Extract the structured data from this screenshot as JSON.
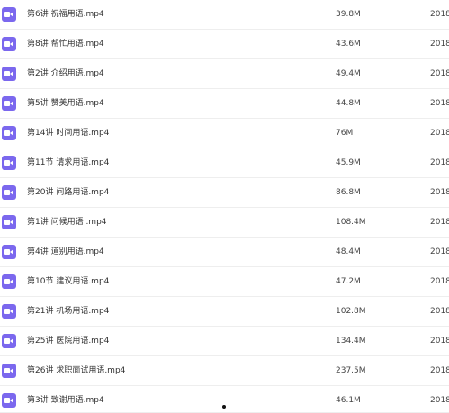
{
  "files": [
    {
      "name": "第6讲 祝福用语.mp4",
      "size": "39.8M",
      "date": "2018-"
    },
    {
      "name": "第8讲 帮忙用语.mp4",
      "size": "43.6M",
      "date": "2018-"
    },
    {
      "name": "第2讲 介绍用语.mp4",
      "size": "49.4M",
      "date": "2018-"
    },
    {
      "name": "第5讲 赞美用语.mp4",
      "size": "44.8M",
      "date": "2018-"
    },
    {
      "name": "第14讲 时间用语.mp4",
      "size": "76M",
      "date": "2018-"
    },
    {
      "name": "第11节 请求用语.mp4",
      "size": "45.9M",
      "date": "2018-"
    },
    {
      "name": "第20讲 问路用语.mp4",
      "size": "86.8M",
      "date": "2018-"
    },
    {
      "name": "第1讲 问候用语 .mp4",
      "size": "108.4M",
      "date": "2018-"
    },
    {
      "name": "第4讲 道别用语.mp4",
      "size": "48.4M",
      "date": "2018-"
    },
    {
      "name": "第10节 建议用语.mp4",
      "size": "47.2M",
      "date": "2018-"
    },
    {
      "name": "第21讲 机场用语.mp4",
      "size": "102.8M",
      "date": "2018-"
    },
    {
      "name": "第25讲 医院用语.mp4",
      "size": "134.4M",
      "date": "2018-"
    },
    {
      "name": "第26讲 求职面试用语.mp4",
      "size": "237.5M",
      "date": "2018-"
    },
    {
      "name": "第3讲 致谢用语.mp4",
      "size": "46.1M",
      "date": "2018-"
    }
  ],
  "icon": "video-file-icon",
  "icon_color": "#7b68ee"
}
